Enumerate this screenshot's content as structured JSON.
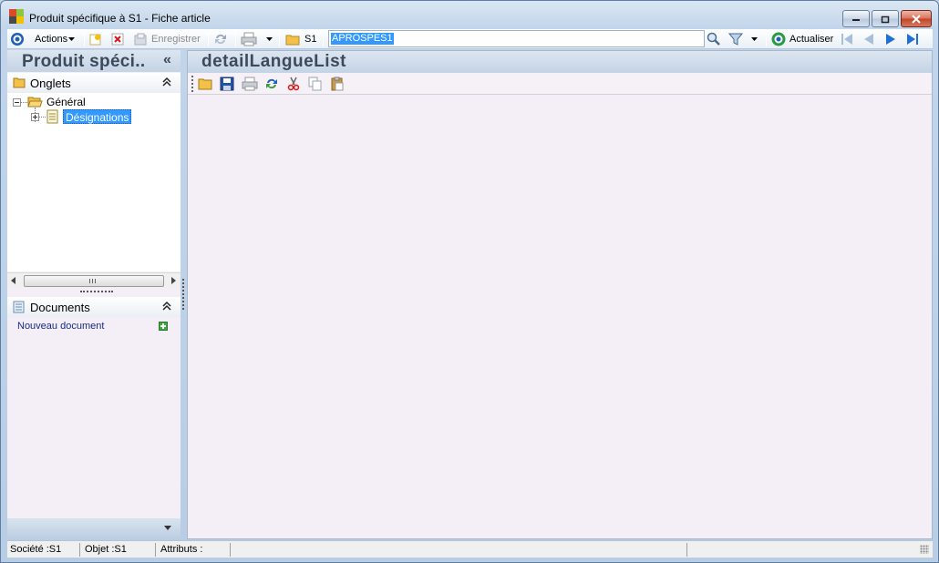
{
  "window": {
    "title": "Produit spécifique à S1 -  Fiche article"
  },
  "toolbar": {
    "actions_label": "Actions",
    "save_label": "Enregistrer",
    "company_label": "S1",
    "search_value": "APROSPES1",
    "refresh_label": "Actualiser"
  },
  "left_pane": {
    "title": "Produit spéci..",
    "collapse_glyph": "«",
    "tabs_section": {
      "label": "Onglets",
      "tree": [
        {
          "label": "Général",
          "children": [
            {
              "label": "Désignations",
              "selected": true
            }
          ]
        }
      ]
    },
    "documents_section": {
      "label": "Documents",
      "new_document_label": "Nouveau document"
    }
  },
  "right_pane": {
    "title": "detailLangueList"
  },
  "statusbar": {
    "company": "Société :S1",
    "object": "Objet :S1",
    "attributes": "Attributs :"
  },
  "colors": {
    "accent": "#3399ff",
    "header_text": "#3d4a5b",
    "link": "#1a2a8a"
  }
}
